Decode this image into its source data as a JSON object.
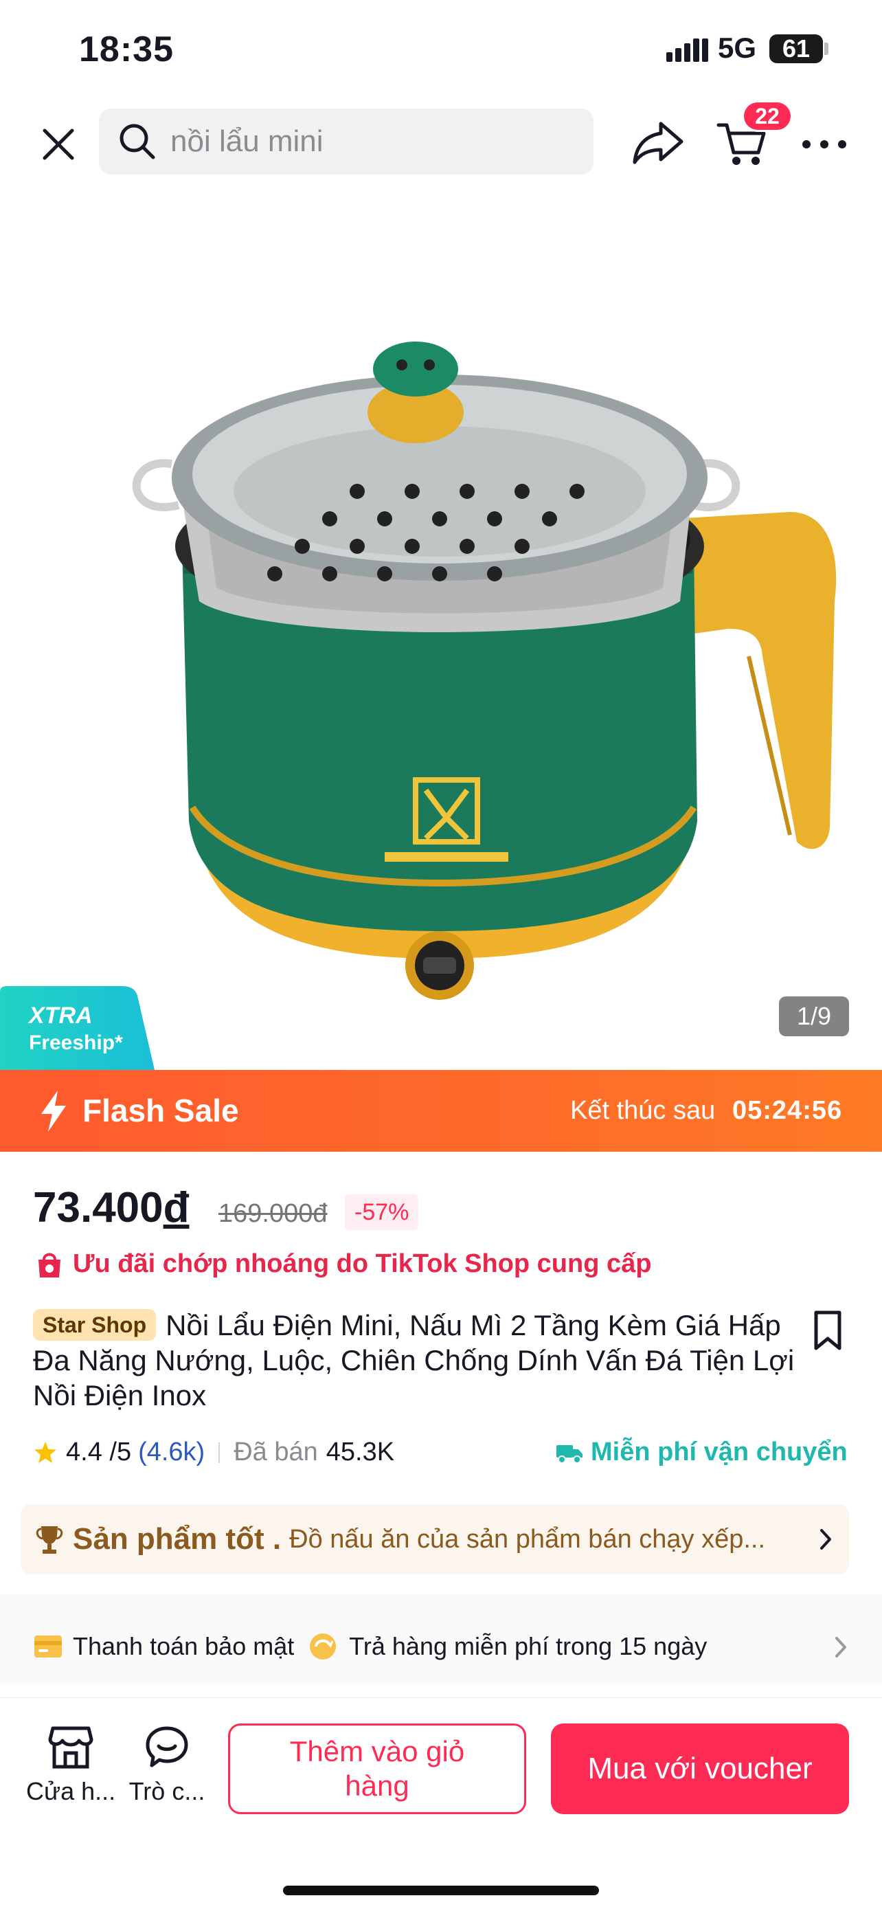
{
  "status_bar": {
    "time": "18:35",
    "network": "5G",
    "battery": "61"
  },
  "search": {
    "query": "nồi lẩu mini"
  },
  "cart": {
    "badge_count": "22"
  },
  "gallery": {
    "pager": "1/9",
    "badge_line1": "XTRA",
    "badge_line2": "Freeship*"
  },
  "flash_sale": {
    "label": "Flash Sale",
    "ends_label": "Kết thúc sau",
    "timer": "05:24:56"
  },
  "price": {
    "current": "73.400",
    "currency": "đ",
    "original": "169.000đ",
    "discount": "-57%"
  },
  "promo": {
    "text": "Ưu đãi chớp nhoáng do TikTok Shop cung cấp"
  },
  "product": {
    "shop_tag": "Star Shop",
    "title": "Nồi Lẩu Điện Mini, Nấu Mì 2 Tầng Kèm Giá Hấp Đa Năng  Nướng, Luộc, Chiên Chống Dính Vấn Đá Tiện Lợi Nồi Điện Inox"
  },
  "stats": {
    "rating": "4.4 /5",
    "review_count": "(4.6k)",
    "sold_label": "Đã bán",
    "sold_value": "45.3K",
    "free_shipping": "Miễn phí vận chuyển"
  },
  "good_product": {
    "heading": "Sản phẩm tốt .",
    "description": "Đồ nấu ăn của sản phẩm bán chạy xếp..."
  },
  "guarantee": {
    "secure_payment": "Thanh toán bảo mật",
    "free_return": "Trả hàng miễn phí trong 15 ngày"
  },
  "bottom_bar": {
    "store_label": "Cửa h...",
    "chat_label": "Trò c...",
    "add_to_cart": "Thêm vào giỏ hàng",
    "buy_now": "Mua với voucher"
  },
  "colors": {
    "accent": "#fe2c55",
    "flash": "#ff5a2e",
    "freeship": "#1fb8ae",
    "product_green": "#1d7a5c",
    "product_yellow": "#f3b72d"
  },
  "icons": [
    "close-icon",
    "search-icon",
    "share-icon",
    "cart-icon",
    "more-icon",
    "bolt-icon",
    "shop-bag-icon",
    "bookmark-icon",
    "star-icon",
    "truck-icon",
    "trophy-icon",
    "chevron-right-icon",
    "card-icon",
    "return-icon",
    "store-icon",
    "chat-icon"
  ]
}
